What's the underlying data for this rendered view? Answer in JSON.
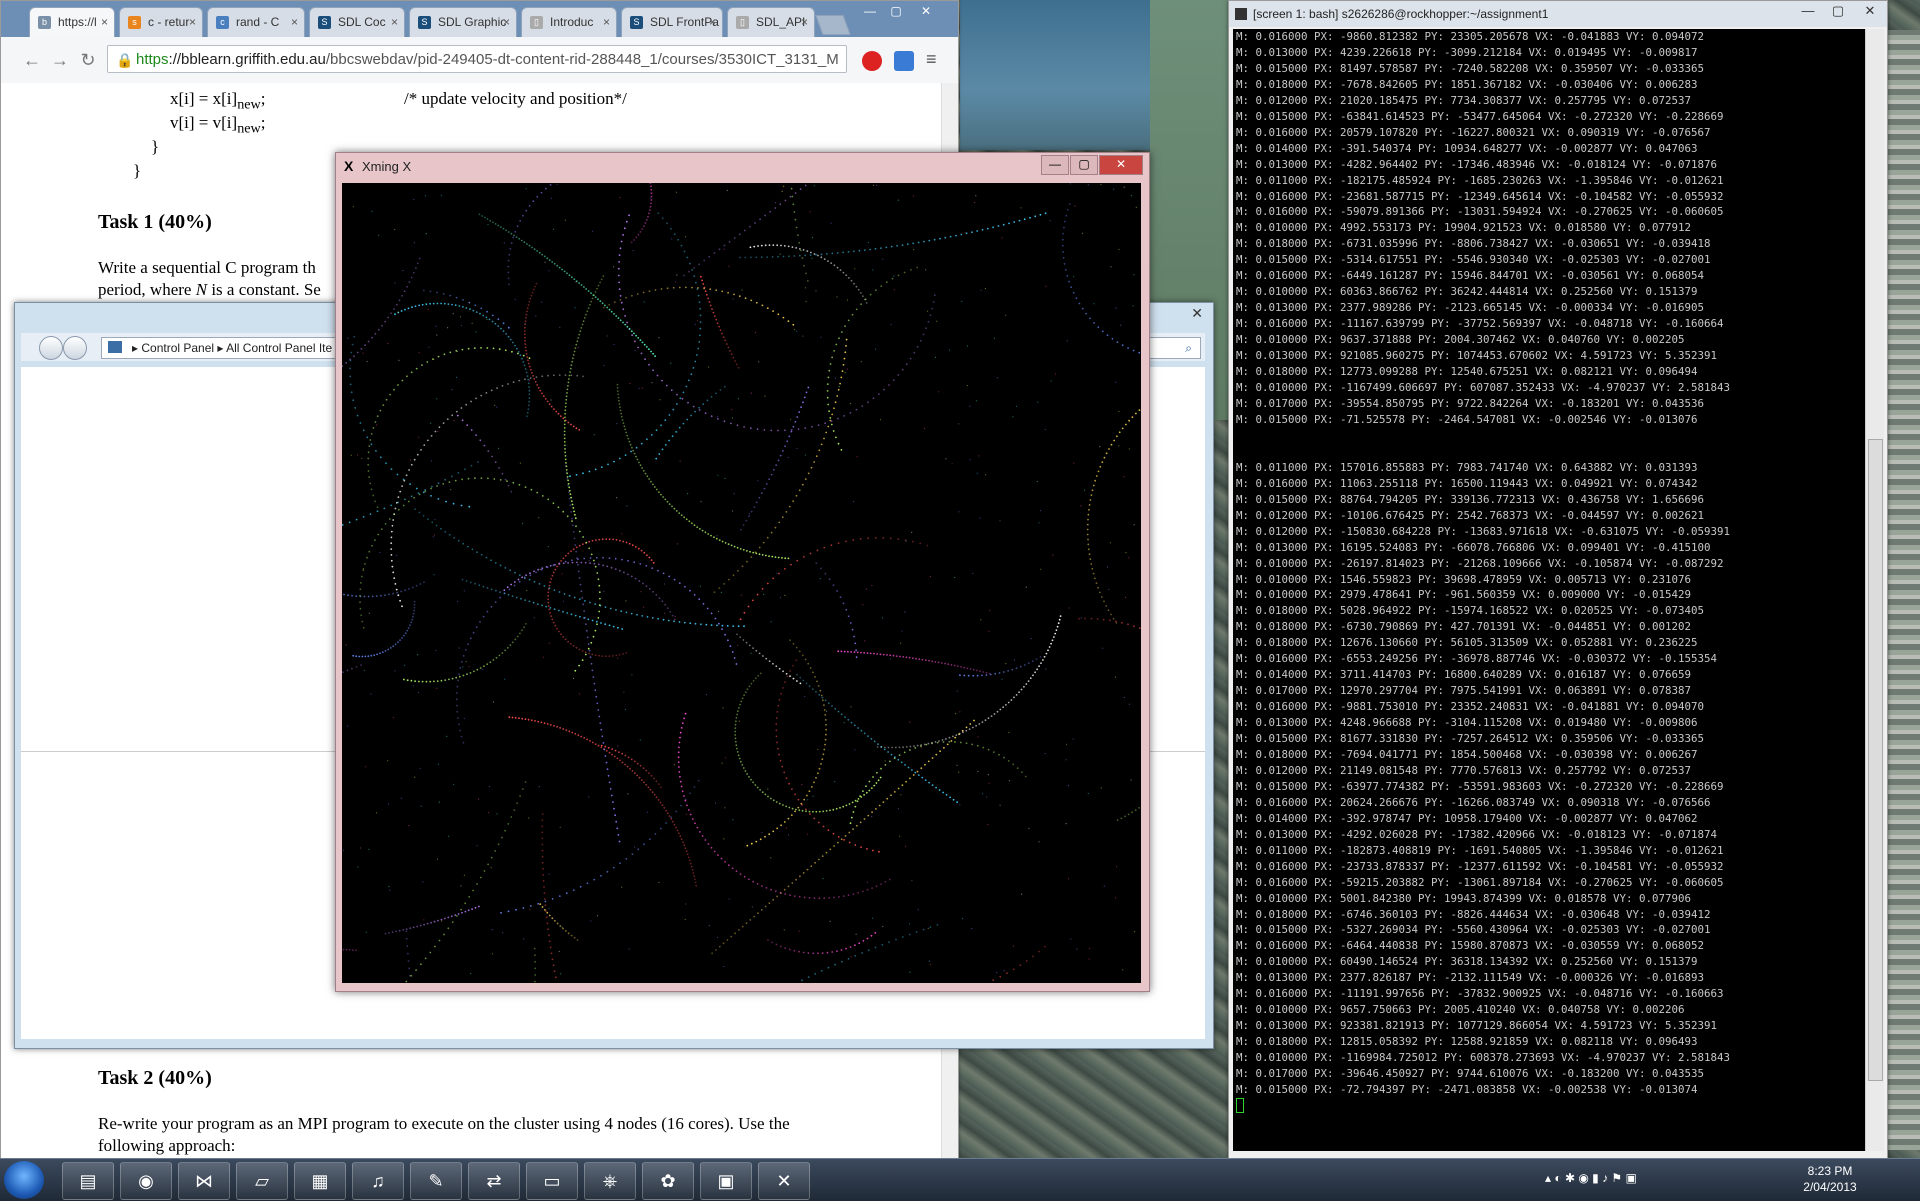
{
  "browser": {
    "tabs": [
      {
        "label": "https://l",
        "icon": "bb-icon",
        "active": true
      },
      {
        "label": "c - retur",
        "icon": "so-icon"
      },
      {
        "label": "rand - C",
        "icon": "cpp-icon"
      },
      {
        "label": "SDL Coc",
        "icon": "sdl-icon"
      },
      {
        "label": "SDL Graphic",
        "icon": "sdl-icon"
      },
      {
        "label": "Introduc",
        "icon": "page-icon"
      },
      {
        "label": "SDL FrontPa",
        "icon": "sdl-icon"
      },
      {
        "label": "SDL_API",
        "icon": "page-icon"
      }
    ],
    "url_https": "https",
    "url_domain": "://bblearn.griffith.edu.au",
    "url_rest": "/bbcswebdav/pid-249405-dt-content-rid-288448_1/courses/3530ICT_3131_M",
    "code_line1": "x[i] = x[i]",
    "code_line1_sub": "new",
    "code_line1_semi": ";",
    "code_comment": "/* update velocity and position*/",
    "code_line2": "v[i] = v[i]",
    "code_line2_sub": "new",
    "code_line2_semi": ";",
    "brace1": "}",
    "brace2": "}",
    "task1_heading": "Task 1 (40%)",
    "task1_line1": "Write a sequential C program th",
    "task1_line2_a": "period, where ",
    "task1_line2_n": "N",
    "task1_line2_b": " is a constant.  Se",
    "task2_heading": "Task 2 (40%)",
    "task2_line1": "Re-write your program as an MPI program to execute on the cluster using 4 nodes (16 cores). Use the",
    "task2_line2": "following approach:"
  },
  "control_panel": {
    "crumb1": "Control Panel",
    "crumb2": "All Control Panel Ite",
    "search_icon": "search-icon"
  },
  "xming": {
    "title": "Xming X"
  },
  "terminal": {
    "title": "[screen 1: bash] s2626286@rockhopper:~/assignment1",
    "block1": [
      "M: 0.016000 PX: -9860.812382 PY: 23305.205678 VX: -0.041883 VY: 0.094072",
      "M: 0.013000 PX: 4239.226618 PY: -3099.212184 VX: 0.019495 VY: -0.009817",
      "M: 0.015000 PX: 81497.578587 PY: -7240.582208 VX: 0.359507 VY: -0.033365",
      "M: 0.018000 PX: -7678.842605 PY: 1851.367182 VX: -0.030406 VY: 0.006283",
      "M: 0.012000 PX: 21020.185475 PY: 7734.308377 VX: 0.257795 VY: 0.072537",
      "M: 0.015000 PX: -63841.614523 PY: -53477.645064 VX: -0.272320 VY: -0.228669",
      "M: 0.016000 PX: 20579.107820 PY: -16227.800321 VX: 0.090319 VY: -0.076567",
      "M: 0.014000 PX: -391.540374 PY: 10934.648277 VX: -0.002877 VY: 0.047063",
      "M: 0.013000 PX: -4282.964402 PY: -17346.483946 VX: -0.018124 VY: -0.071876",
      "M: 0.011000 PX: -182175.485924 PY: -1685.230263 VX: -1.395846 VY: -0.012621",
      "M: 0.016000 PX: -23681.587715 PY: -12349.645614 VX: -0.104582 VY: -0.055932",
      "M: 0.016000 PX: -59079.891366 PY: -13031.594924 VX: -0.270625 VY: -0.060605",
      "M: 0.010000 PX: 4992.553173 PY: 19904.921523 VX: 0.018580 VY: 0.077912",
      "M: 0.018000 PX: -6731.035996 PY: -8806.738427 VX: -0.030651 VY: -0.039418",
      "M: 0.015000 PX: -5314.617551 PY: -5546.930340 VX: -0.025303 VY: -0.027001",
      "M: 0.016000 PX: -6449.161287 PY: 15946.844701 VX: -0.030561 VY: 0.068054",
      "M: 0.010000 PX: 60363.866762 PY: 36242.444814 VX: 0.252560 VY: 0.151379",
      "M: 0.013000 PX: 2377.989286 PY: -2123.665145 VX: -0.000334 VY: -0.016905",
      "M: 0.016000 PX: -11167.639799 PY: -37752.569397 VX: -0.048718 VY: -0.160664",
      "M: 0.010000 PX: 9637.371888 PY: 2004.307462 VX: 0.040760 VY: 0.002205",
      "M: 0.013000 PX: 921085.960275 PY: 1074453.670602 VX: 4.591723 VY: 5.352391",
      "M: 0.018000 PX: 12773.099288 PY: 12540.675251 VX: 0.082121 VY: 0.096494",
      "M: 0.010000 PX: -1167499.606697 PY: 607087.352433 VX: -4.970237 VY: 2.581843",
      "M: 0.017000 PX: -39554.850795 PY: 9722.842264 VX: -0.183201 VY: 0.043536",
      "M: 0.015000 PX: -71.525578 PY: -2464.547081 VX: -0.002546 VY: -0.013076"
    ],
    "block2": [
      "M: 0.011000 PX: 157016.855883 PY: 7983.741740 VX: 0.643882 VY: 0.031393",
      "M: 0.016000 PX: 11063.255118 PY: 16500.119443 VX: 0.049921 VY: 0.074342",
      "M: 0.015000 PX: 88764.794205 PY: 339136.772313 VX: 0.436758 VY: 1.656696",
      "M: 0.012000 PX: -10106.676425 PY: 2542.768373 VX: -0.044597 VY: 0.002621",
      "M: 0.012000 PX: -150830.684228 PY: -13683.971618 VX: -0.631075 VY: -0.059391",
      "M: 0.013000 PX: 16195.524083 PY: -66078.766806 VX: 0.099401 VY: -0.415100",
      "M: 0.010000 PX: -26197.814023 PY: -21268.109666 VX: -0.105874 VY: -0.087292",
      "M: 0.010000 PX: 1546.559823 PY: 39698.478959 VX: 0.005713 VY: 0.231076",
      "M: 0.010000 PX: 2979.478641 PY: -961.560359 VX: 0.009000 VY: -0.015429",
      "M: 0.018000 PX: 5028.964922 PY: -15974.168522 VX: 0.020525 VY: -0.073405",
      "M: 0.018000 PX: -6730.790869 PY: 427.701391 VX: -0.044851 VY: 0.001202",
      "M: 0.018000 PX: 12676.130660 PY: 56105.313509 VX: 0.052881 VY: 0.236225",
      "M: 0.016000 PX: -6553.249256 PY: -36978.887746 VX: -0.030372 VY: -0.155354",
      "M: 0.014000 PX: 3711.414703 PY: 16800.640289 VX: 0.016187 VY: 0.076659",
      "M: 0.017000 PX: 12970.297704 PY: 7975.541991 VX: 0.063891 VY: 0.078387",
      "M: 0.016000 PX: -9881.753010 PY: 23352.240831 VX: -0.041881 VY: 0.094070",
      "M: 0.013000 PX: 4248.966688 PY: -3104.115208 VX: 0.019480 VY: -0.009806",
      "M: 0.015000 PX: 81677.331830 PY: -7257.264512 VX: 0.359506 VY: -0.033365",
      "M: 0.018000 PX: -7694.041771 PY: 1854.500468 VX: -0.030398 VY: 0.006267",
      "M: 0.012000 PX: 21149.081548 PY: 7770.576813 VX: 0.257792 VY: 0.072537",
      "M: 0.015000 PX: -63977.774382 PY: -53591.983603 VX: -0.272320 VY: -0.228669",
      "M: 0.016000 PX: 20624.266676 PY: -16266.083749 VX: 0.090318 VY: -0.076566",
      "M: 0.014000 PX: -392.978747 PY: 10958.179400 VX: -0.002877 VY: 0.047062",
      "M: 0.013000 PX: -4292.026028 PY: -17382.420966 VX: -0.018123 VY: -0.071874",
      "M: 0.011000 PX: -182873.408819 PY: -1691.540805 VX: -1.395846 VY: -0.012621",
      "M: 0.016000 PX: -23733.878337 PY: -12377.611592 VX: -0.104581 VY: -0.055932",
      "M: 0.016000 PX: -59215.203882 PY: -13061.897184 VX: -0.270625 VY: -0.060605",
      "M: 0.010000 PX: 5001.842380 PY: 19943.874399 VX: 0.018578 VY: 0.077906",
      "M: 0.018000 PX: -6746.360103 PY: -8826.444634 VX: -0.030648 VY: -0.039412",
      "M: 0.015000 PX: -5327.269034 PY: -5560.430964 VX: -0.025303 VY: -0.027001",
      "M: 0.016000 PX: -6464.440838 PY: 15980.870873 VX: -0.030559 VY: 0.068052",
      "M: 0.010000 PX: 60490.146524 PY: 36318.134392 VX: 0.252560 VY: 0.151379",
      "M: 0.013000 PX: 2377.826187 PY: -2132.111549 VX: -0.000326 VY: -0.016893",
      "M: 0.016000 PX: -11191.997656 PY: -37832.900925 VX: -0.048716 VY: -0.160663",
      "M: 0.010000 PX: 9657.750663 PY: 2005.410240 VX: 0.040758 VY: 0.002206",
      "M: 0.013000 PX: 923381.821913 PY: 1077129.866054 VX: 4.591723 VY: 5.352391",
      "M: 0.018000 PX: 12815.058392 PY: 12588.921859 VX: 0.082118 VY: 0.096493",
      "M: 0.010000 PX: -1169984.725012 PY: 608378.273693 VX: -4.970237 VY: 2.581843",
      "M: 0.017000 PX: -39646.450927 PY: 9744.610076 VX: -0.183200 VY: 0.043535",
      "M: 0.015000 PX: -72.794397 PY: -2471.083858 VX: -0.002538 VY: -0.013074"
    ]
  },
  "taskbar": {
    "apps": [
      "folder-icon",
      "chrome-icon",
      "visual-studio-icon",
      "notepad-icon",
      "calculator-icon",
      "itunes-icon",
      "acrobat-icon",
      "teamviewer-icon",
      "cmd-icon",
      "network-icon",
      "paint-icon",
      "control-panel-icon",
      "xming-icon"
    ],
    "time": "8:23 PM",
    "date": "2/04/2013"
  },
  "colors": {
    "terminal_bg": "#000000",
    "terminal_fg": "#c8c8c8",
    "https_green": "#1d8a1d"
  }
}
